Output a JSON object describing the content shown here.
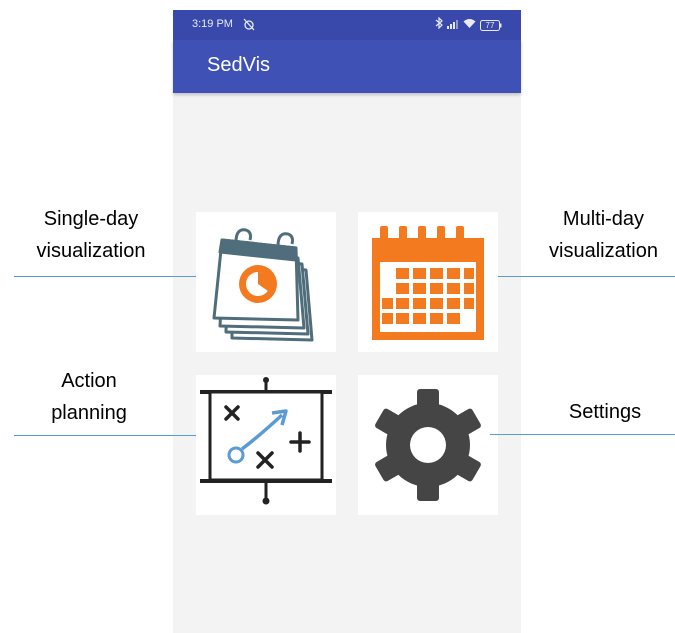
{
  "status_bar": {
    "time": "3:19 PM",
    "alarm_icon": "alarm-off-icon",
    "icons": [
      "bluetooth-icon",
      "signal-icon",
      "wifi-icon",
      "battery-icon"
    ],
    "battery_level": "77"
  },
  "app_bar": {
    "title": "SedVis"
  },
  "tiles": [
    {
      "name": "single-day-visualization",
      "icon": "calendar-pie-icon"
    },
    {
      "name": "multi-day-visualization",
      "icon": "calendar-grid-icon"
    },
    {
      "name": "action-planning",
      "icon": "whiteboard-plan-icon"
    },
    {
      "name": "settings",
      "icon": "gear-icon"
    }
  ],
  "callouts": {
    "single_day": {
      "line1": "Single-day",
      "line2": "visualization"
    },
    "multi_day": {
      "line1": "Multi-day",
      "line2": "visualization"
    },
    "action_planning": {
      "line1": "Action",
      "line2": "planning"
    },
    "settings": {
      "line1": "Settings"
    }
  },
  "colors": {
    "app_bar": "#3f51b5",
    "status_bar": "#3949ab",
    "leader_line": "#5b9bd5",
    "calendar_orange": "#f47a20",
    "calendar_slate": "#4f6d7a",
    "planning_blue": "#5b9bd5",
    "gear_gray": "#454545"
  }
}
